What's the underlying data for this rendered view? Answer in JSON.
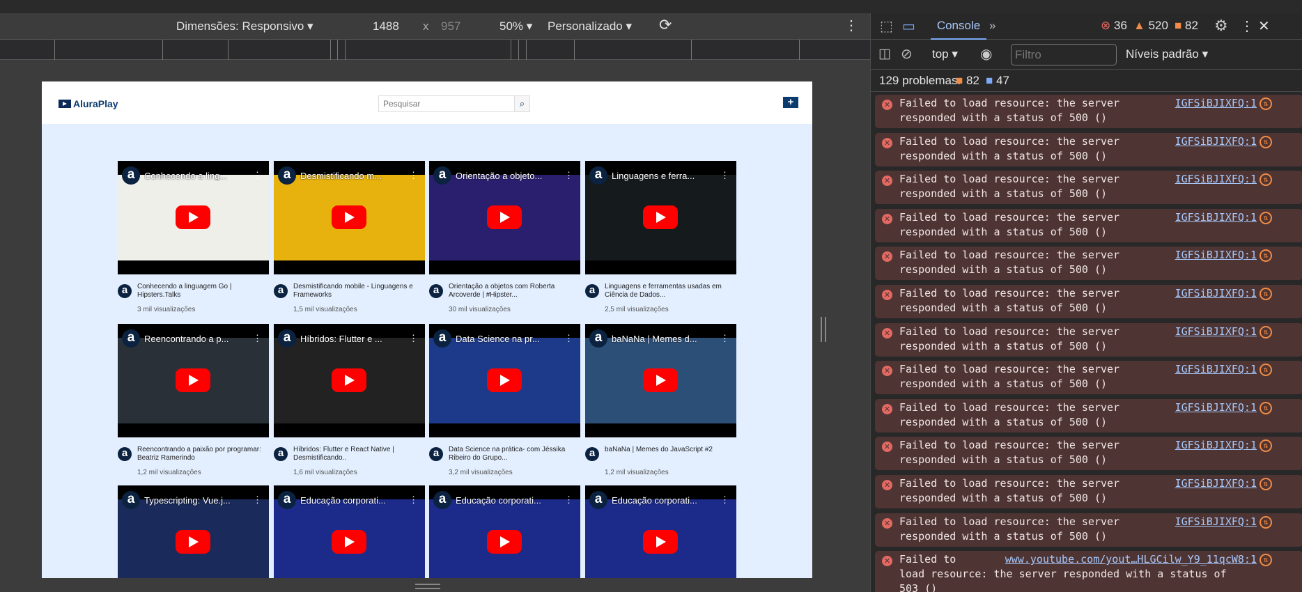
{
  "device_toolbar": {
    "dimensions_label": "Dimensões: Responsivo",
    "width": "1488",
    "times": "x",
    "height": "957",
    "zoom": "50%",
    "throttle": "Personalizado",
    "rotate_icon": "rotate-icon",
    "more_icon": "more-vertical-icon"
  },
  "site": {
    "logo_text": "AluraPlay",
    "search_placeholder": "Pesquisar",
    "background": "#e3efff",
    "videos": [
      {
        "overlay": "Conhecendo a ling...",
        "title": "Conhecendo a linguagem Go | Hipsters.Talks",
        "views": "3 mil visualizações",
        "color": "#efefea"
      },
      {
        "overlay": "Desmistificando m...",
        "title": "Desmistificando mobile - Linguagens e Frameworks",
        "views": "1,5 mil visualizações",
        "color": "#e7b20d"
      },
      {
        "overlay": "Orientação a objeto...",
        "title": "Orientação a objetos com Roberta Arcoverde | #Hipster...",
        "views": "30 mil visualizações",
        "color": "#2a1f6e"
      },
      {
        "overlay": "Linguagens e ferra...",
        "title": "Linguagens e ferramentas usadas em Ciência de Dados...",
        "views": "2,5 mil visualizações",
        "color": "#151a1c"
      },
      {
        "overlay": "Reencontrando a p...",
        "title": "Reencontrando a paixão por programar: Beatriz Ramerindo",
        "views": "1,2 mil visualizações",
        "color": "#2a3038"
      },
      {
        "overlay": "Híbridos: Flutter e ...",
        "title": "Híbridos: Flutter e React Native | Desmistificando..",
        "views": "1,6 mil visualizações",
        "color": "#222"
      },
      {
        "overlay": "Data Science na pr...",
        "title": "Data Science na prática- com Jéssika Ribeiro do Grupo...",
        "views": "3,2 mil visualizações",
        "color": "#1d3a8a"
      },
      {
        "overlay": "baNaNa | Memes d...",
        "title": "baNaNa | Memes do JavaScript #2",
        "views": "1,2 mil visualizações",
        "color": "#2c4f78"
      },
      {
        "overlay": "Typescripting: Vue.j...",
        "title": "",
        "views": "",
        "color": "#1a2a5a"
      },
      {
        "overlay": "Educação corporati...",
        "title": "",
        "views": "",
        "color": "#1c2a8a"
      },
      {
        "overlay": "Educação corporati...",
        "title": "",
        "views": "",
        "color": "#1c2a8a"
      },
      {
        "overlay": "Educação corporati...",
        "title": "",
        "views": "",
        "color": "#1c2a8a"
      }
    ]
  },
  "devtools": {
    "tab": "Console",
    "more_tabs": "»",
    "errors": "36",
    "warnings": "520",
    "issues": "82",
    "context": "top",
    "filter_placeholder": "Filtro",
    "levels": "Níveis padrão",
    "problems_label": "129 problemas:",
    "problems_issues": "82",
    "problems_info": "47",
    "messages": [
      {
        "l1": "Failed to load resource: the server",
        "l2": "responded with a status of 500 ()",
        "src": "IGFSiBJIXFQ:1"
      },
      {
        "l1": "Failed to load resource: the server",
        "l2": "responded with a status of 500 ()",
        "src": "IGFSiBJIXFQ:1"
      },
      {
        "l1": "Failed to load resource: the server",
        "l2": "responded with a status of 500 ()",
        "src": "IGFSiBJIXFQ:1"
      },
      {
        "l1": "Failed to load resource: the server",
        "l2": "responded with a status of 500 ()",
        "src": "IGFSiBJIXFQ:1"
      },
      {
        "l1": "Failed to load resource: the server",
        "l2": "responded with a status of 500 ()",
        "src": "IGFSiBJIXFQ:1"
      },
      {
        "l1": "Failed to load resource: the server",
        "l2": "responded with a status of 500 ()",
        "src": "IGFSiBJIXFQ:1"
      },
      {
        "l1": "Failed to load resource: the server",
        "l2": "responded with a status of 500 ()",
        "src": "IGFSiBJIXFQ:1"
      },
      {
        "l1": "Failed to load resource: the server",
        "l2": "responded with a status of 500 ()",
        "src": "IGFSiBJIXFQ:1"
      },
      {
        "l1": "Failed to load resource: the server",
        "l2": "responded with a status of 500 ()",
        "src": "IGFSiBJIXFQ:1"
      },
      {
        "l1": "Failed to load resource: the server",
        "l2": "responded with a status of 500 ()",
        "src": "IGFSiBJIXFQ:1"
      },
      {
        "l1": "Failed to load resource: the server",
        "l2": "responded with a status of 500 ()",
        "src": "IGFSiBJIXFQ:1"
      },
      {
        "l1": "Failed to load resource: the server",
        "l2": "responded with a status of 500 ()",
        "src": "IGFSiBJIXFQ:1"
      },
      {
        "l1": "Failed to",
        "l2": "load resource: the server responded with a status of",
        "l3": "503 ()",
        "src": "www.youtube.com/yout…HLGCilw_Y9_11qcW8:1"
      }
    ]
  }
}
